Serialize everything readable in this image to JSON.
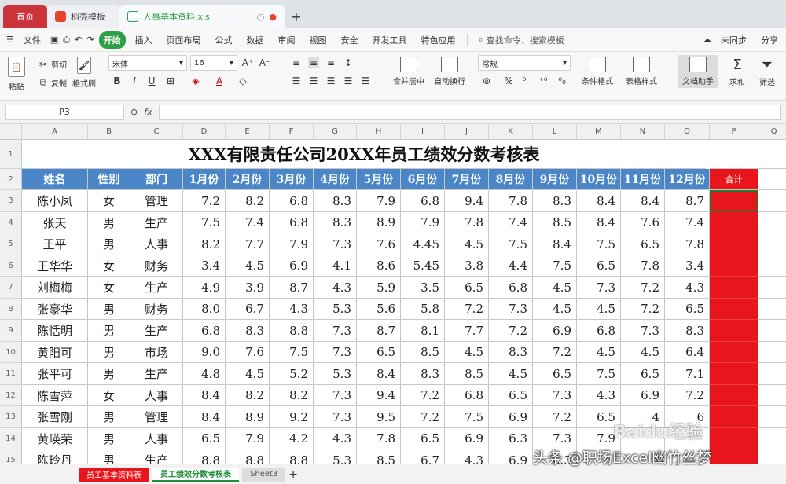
{
  "tabs": [
    {
      "label": "首页"
    },
    {
      "label": "稻壳模板"
    },
    {
      "label": "人事基本资料.xls"
    }
  ],
  "menu": [
    "文件",
    "开始",
    "插入",
    "页面布局",
    "公式",
    "数据",
    "审阅",
    "视图",
    "安全",
    "开发工具",
    "特色应用"
  ],
  "menu_active": "开始",
  "search_label": "查找命令、搜索模板",
  "right_actions": [
    "未同步",
    "分享"
  ],
  "ribbon": {
    "paste": "粘贴",
    "cut": "剪切",
    "copy": "复制",
    "format_painter": "格式刷",
    "font_name": "宋体",
    "font_size": "16",
    "merge_center": "合并居中",
    "wrap": "自动换行",
    "number_format": "常规",
    "conditional_format": "条件格式",
    "table_style": "表格样式",
    "doc_assistant": "文档助手",
    "sum": "求和",
    "filter": "筛选"
  },
  "name_box": "P3",
  "fx_label": "fx",
  "columns": [
    "A",
    "B",
    "C",
    "D",
    "E",
    "F",
    "G",
    "H",
    "I",
    "J",
    "K",
    "L",
    "M",
    "N",
    "O",
    "P",
    "Q"
  ],
  "title": "XXX有限责任公司20XX年员工绩效分数考核表",
  "headers": [
    "姓名",
    "性别",
    "部门",
    "1月份",
    "2月份",
    "3月份",
    "4月份",
    "5月份",
    "6月份",
    "7月份",
    "8月份",
    "9月份",
    "10月份",
    "11月份",
    "12月份",
    "合计"
  ],
  "rows": [
    {
      "name": "陈小凤",
      "gender": "女",
      "dept": "管理",
      "scores": [
        "7.2",
        "8.2",
        "6.8",
        "8.3",
        "7.9",
        "6.8",
        "9.4",
        "7.8",
        "8.3",
        "8.4",
        "8.4",
        "8.7"
      ]
    },
    {
      "name": "张天",
      "gender": "男",
      "dept": "生产",
      "scores": [
        "7.5",
        "7.4",
        "6.8",
        "8.3",
        "8.9",
        "7.9",
        "7.8",
        "7.4",
        "8.5",
        "8.4",
        "7.6",
        "7.4"
      ]
    },
    {
      "name": "王平",
      "gender": "男",
      "dept": "人事",
      "scores": [
        "8.2",
        "7.7",
        "7.9",
        "7.3",
        "7.6",
        "4.45",
        "4.5",
        "7.5",
        "8.4",
        "7.5",
        "6.5",
        "7.8"
      ]
    },
    {
      "name": "王华华",
      "gender": "女",
      "dept": "财务",
      "scores": [
        "3.4",
        "4.5",
        "6.9",
        "4.1",
        "8.6",
        "5.45",
        "3.8",
        "4.4",
        "7.5",
        "6.5",
        "7.8",
        "3.4"
      ]
    },
    {
      "name": "刘梅梅",
      "gender": "女",
      "dept": "生产",
      "scores": [
        "4.9",
        "3.9",
        "8.7",
        "4.3",
        "5.9",
        "3.5",
        "6.5",
        "6.8",
        "4.5",
        "7.3",
        "7.2",
        "4.3"
      ]
    },
    {
      "name": "张豪华",
      "gender": "男",
      "dept": "财务",
      "scores": [
        "8.0",
        "6.7",
        "4.3",
        "5.3",
        "5.6",
        "5.8",
        "7.2",
        "7.3",
        "4.5",
        "4.5",
        "7.2",
        "6.5"
      ]
    },
    {
      "name": "陈恬明",
      "gender": "男",
      "dept": "生产",
      "scores": [
        "6.8",
        "8.3",
        "8.8",
        "7.3",
        "8.7",
        "8.1",
        "7.7",
        "7.2",
        "6.9",
        "6.8",
        "7.3",
        "8.3"
      ]
    },
    {
      "name": "黄阳可",
      "gender": "男",
      "dept": "市场",
      "scores": [
        "9.0",
        "7.6",
        "7.5",
        "7.3",
        "6.5",
        "8.5",
        "4.5",
        "8.3",
        "7.2",
        "4.5",
        "4.5",
        "6.4"
      ]
    },
    {
      "name": "张平可",
      "gender": "男",
      "dept": "生产",
      "scores": [
        "4.8",
        "4.5",
        "5.2",
        "5.3",
        "8.4",
        "8.3",
        "8.5",
        "4.5",
        "6.5",
        "7.5",
        "6.5",
        "7.1"
      ]
    },
    {
      "name": "陈雪萍",
      "gender": "女",
      "dept": "人事",
      "scores": [
        "8.4",
        "8.2",
        "8.2",
        "7.3",
        "9.4",
        "7.2",
        "6.8",
        "6.5",
        "7.3",
        "4.3",
        "6.9",
        "7.2"
      ]
    },
    {
      "name": "张雪刚",
      "gender": "男",
      "dept": "管理",
      "scores": [
        "8.4",
        "8.9",
        "9.2",
        "7.3",
        "9.5",
        "7.2",
        "7.5",
        "6.9",
        "7.2",
        "6.5",
        "4",
        "6"
      ]
    },
    {
      "name": "黄瑛荣",
      "gender": "男",
      "dept": "人事",
      "scores": [
        "6.5",
        "7.9",
        "4.2",
        "4.3",
        "7.8",
        "6.5",
        "6.9",
        "6.3",
        "7.3",
        "7.9",
        "",
        ""
      ]
    },
    {
      "name": "陈玲丹",
      "gender": "男",
      "dept": "生产",
      "scores": [
        "8.8",
        "8.8",
        "8.8",
        "5.3",
        "8.5",
        "6.7",
        "4.3",
        "6.9",
        "6.3",
        "",
        "",
        ""
      ]
    }
  ],
  "sheet_tabs": [
    "员工基本资料表",
    "员工绩效分数考核表",
    "Sheet3"
  ],
  "watermark": "头条 @职场Excel幽竹丝梦",
  "badge": "Baidu经验"
}
